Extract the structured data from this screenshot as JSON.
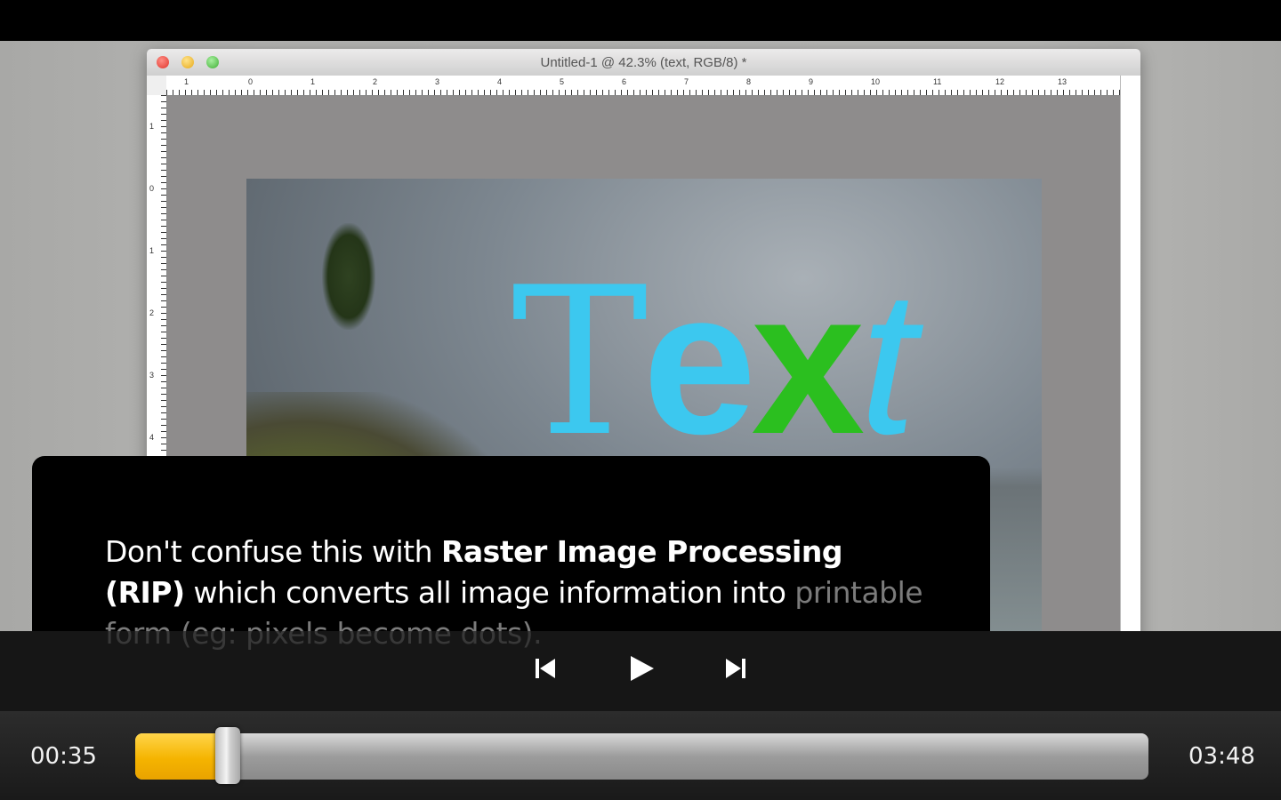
{
  "document": {
    "title": "Untitled-1 @ 42.3% (text, RGB/8) *",
    "ruler_top_numbers": [
      "1",
      "0",
      "1",
      "2",
      "3",
      "4",
      "5",
      "6",
      "7",
      "8",
      "9",
      "10",
      "11",
      "12",
      "13"
    ],
    "ruler_left_numbers": [
      "1",
      "0",
      "1",
      "2",
      "3",
      "4"
    ]
  },
  "canvas": {
    "text_parts": {
      "t1": "T",
      "e": "e",
      "x": "x",
      "t2": "t"
    },
    "colors": {
      "cyan": "#3cc8ef",
      "green": "#2bbf1f"
    }
  },
  "caption": {
    "part1": "Don't confuse this with ",
    "bold": "Raster Image Processing (RIP)",
    "part2": " which converts all image information into ",
    "faded": "printable form (eg: pixels become dots)."
  },
  "controls": {
    "prev_icon": "skip-previous-icon",
    "play_icon": "play-icon",
    "next_icon": "skip-next-icon"
  },
  "player": {
    "current_time": "00:35",
    "total_time": "03:48",
    "progress_fraction": 0.0789,
    "accent_color": "#f5b400"
  }
}
